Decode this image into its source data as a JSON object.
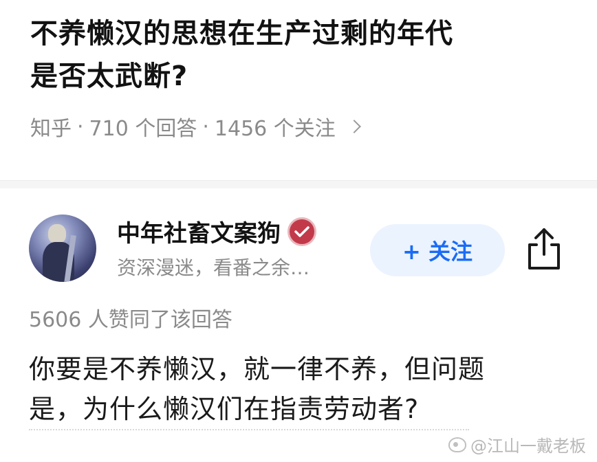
{
  "question": {
    "title_line1": "不养懒汉的思想在生产过剩的年代",
    "title_line2": "是否太武断?",
    "source": "知乎",
    "sep": "·",
    "answers": "710 个回答",
    "followers": "1456 个关注"
  },
  "author": {
    "name": "中年社畜文案狗",
    "bio": "资深漫迷，看番之余…",
    "follow_label": "+ 关注"
  },
  "answer": {
    "agree_text": "5606 人赞同了该回答",
    "line1": "你要是不养懒汉，就一律不养，但问题",
    "line2": "是，为什么懒汉们在指责劳动者?"
  },
  "watermark": {
    "text": "@江山一戴老板"
  },
  "icons": {
    "chevron": "chevron-right-icon",
    "badge": "verified-badge-icon",
    "share": "share-icon",
    "weibo": "weibo-icon"
  },
  "colors": {
    "accent": "#1a6cf5",
    "follow_bg": "#ebf3ff",
    "meta_gray": "#8a8a8a",
    "badge_red": "#c23a4a"
  }
}
